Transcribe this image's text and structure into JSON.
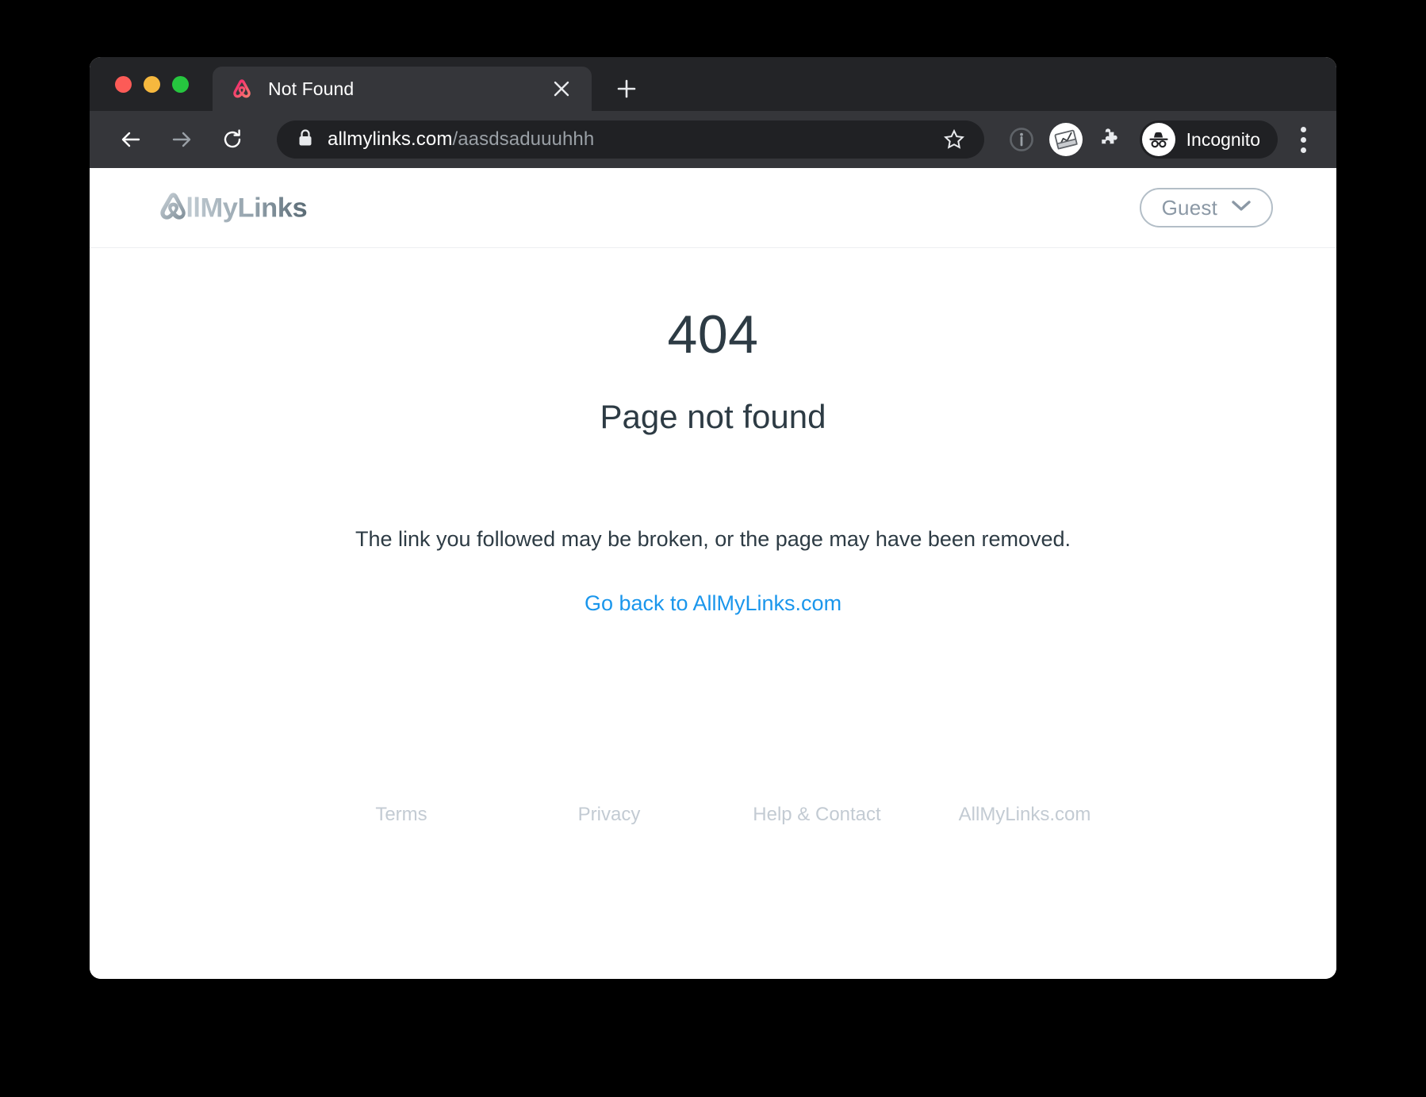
{
  "browser": {
    "traffic_lights": [
      {
        "name": "close",
        "color": "#fc5b57"
      },
      {
        "name": "minimize",
        "color": "#f6b83e"
      },
      {
        "name": "zoom",
        "color": "#26c63f"
      }
    ],
    "tab": {
      "title": "Not Found",
      "favicon_name": "allmylinks-favicon",
      "close_icon": "close-icon"
    },
    "new_tab_icon": "plus-icon",
    "nav": {
      "back_icon": "arrow-left-icon",
      "forward_icon": "arrow-right-icon",
      "reload_icon": "reload-icon"
    },
    "omnibox": {
      "lock_icon": "lock-icon",
      "url_host": "allmylinks.com",
      "url_path": "/aasdsaduuuhhh",
      "url_full": "allmylinks.com/aasdsaduuuhhh",
      "star_icon": "star-icon"
    },
    "toolbar_icons": [
      {
        "name": "info-circle-icon",
        "label": "i"
      },
      {
        "name": "extension-chart-icon",
        "label": ""
      },
      {
        "name": "puzzle-extensions-icon",
        "label": ""
      }
    ],
    "profile": {
      "label": "Incognito",
      "icon": "incognito-hat-glasses-icon"
    },
    "menu_icon": "three-dot-menu-icon"
  },
  "site": {
    "header": {
      "brand": "AllMyLinks",
      "brand_colors": {
        "light": "#c2ccd3",
        "dark": "#5a6b75",
        "mark": "#8d9aa3"
      },
      "account": {
        "label": "Guest",
        "chevron_icon": "chevron-down-icon"
      }
    },
    "main": {
      "error_code": "404",
      "headline": "Page not found",
      "message": "The link you followed may be broken, or the page may have been removed.",
      "back_link": "Go back to AllMyLinks.com",
      "link_color": "#1a96ec"
    },
    "footer": {
      "links": [
        "Terms",
        "Privacy",
        "Help & Contact",
        "AllMyLinks.com"
      ]
    }
  }
}
